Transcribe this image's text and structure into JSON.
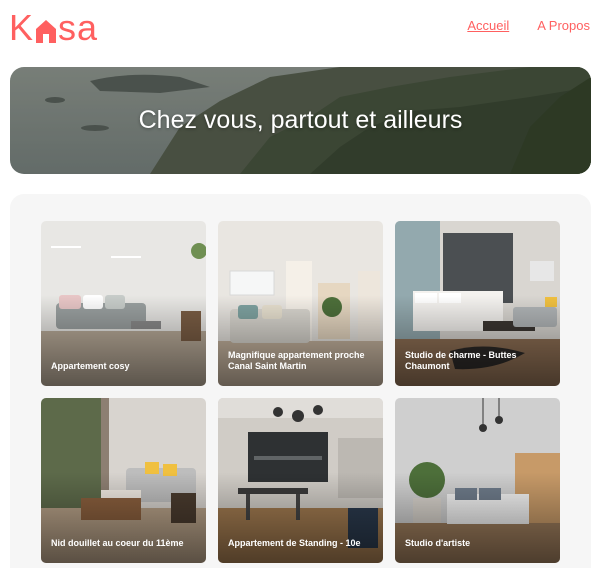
{
  "brand": {
    "logo_left": "K",
    "logo_right": "sa",
    "accent": "#ff6060"
  },
  "nav": {
    "items": [
      {
        "label": "Accueil",
        "active": true
      },
      {
        "label": "A Propos",
        "active": false
      }
    ]
  },
  "banner": {
    "title": "Chez vous, partout et ailleurs"
  },
  "gallery": {
    "cards": [
      {
        "title": "Appartement cosy"
      },
      {
        "title": "Magnifique appartement proche Canal Saint Martin"
      },
      {
        "title": "Studio de charme - Buttes Chaumont"
      },
      {
        "title": "Nid douillet au coeur du 11ème"
      },
      {
        "title": "Appartement de Standing - 10e"
      },
      {
        "title": "Studio d'artiste"
      }
    ]
  }
}
